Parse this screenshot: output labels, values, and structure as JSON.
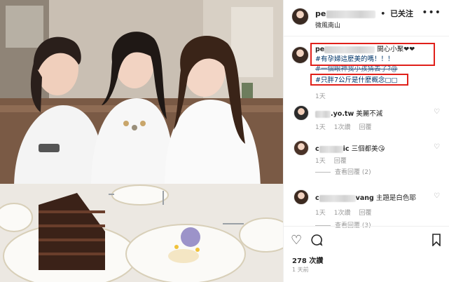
{
  "post": {
    "header": {
      "username_prefix": "pe",
      "dot": "•",
      "follow_label": "已关注",
      "location": "微風南山",
      "more_icon": "more-horizontal-icon"
    },
    "caption": {
      "username_prefix": "pe",
      "text_suffix": "開心小聚❤❤",
      "hashtag1": "#有孕婦這麼美的嗎！！！",
      "hashtag2": "#一個眼神我小孩猜去了?@",
      "hashtag3": "#只胖7公斤是什麼概念□□",
      "time": "1天"
    },
    "comments": [
      {
        "user_suffix": ".yo.tw",
        "text": "美麗不減",
        "time": "1天",
        "likes": "1次讚",
        "reply": "回覆",
        "replies": ""
      },
      {
        "user_prefix": "c",
        "user_suffix": "ic",
        "text": "三個都美😘",
        "time": "1天",
        "likes": "",
        "reply": "回覆",
        "replies": "查看回覆 (2)"
      },
      {
        "user_prefix": "c",
        "user_suffix": "vang",
        "text": "主題是白色耶",
        "time": "1天",
        "likes": "1次讚",
        "reply": "回覆",
        "replies": "查看回覆 (3)"
      }
    ],
    "actions": {
      "like_icon": "heart-icon",
      "comment_icon": "comment-icon",
      "share_icon": "share-icon",
      "save_icon": "bookmark-icon",
      "likes_count": "278 次讚",
      "posted": "1 天前"
    },
    "colors": {
      "hashtag": "#003569",
      "highlight_box": "#e0201a",
      "muted": "#999999"
    }
  }
}
